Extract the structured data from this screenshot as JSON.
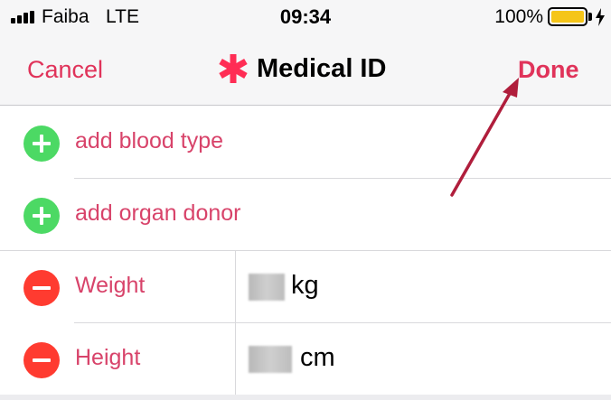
{
  "status_bar": {
    "carrier": "Faiba",
    "network": "LTE",
    "time": "09:34",
    "battery_percent": "100%",
    "battery_color": "#f5c518"
  },
  "nav": {
    "cancel_label": "Cancel",
    "title": "Medical ID",
    "done_label": "Done",
    "accent_color": "#e0335a"
  },
  "rows": [
    {
      "label": "add blood type",
      "action": "add",
      "icon": "plus-circle-icon"
    },
    {
      "label": "add organ donor",
      "action": "add",
      "icon": "plus-circle-icon"
    },
    {
      "label": "Weight",
      "action": "remove",
      "icon": "minus-circle-icon",
      "unit": "kg"
    },
    {
      "label": "Height",
      "action": "remove",
      "icon": "minus-circle-icon",
      "unit": "cm"
    }
  ],
  "colors": {
    "add_green": "#4cd964",
    "remove_red": "#ff3b30",
    "row_label": "#d8436a",
    "annotation_arrow": "#b01e3c"
  }
}
